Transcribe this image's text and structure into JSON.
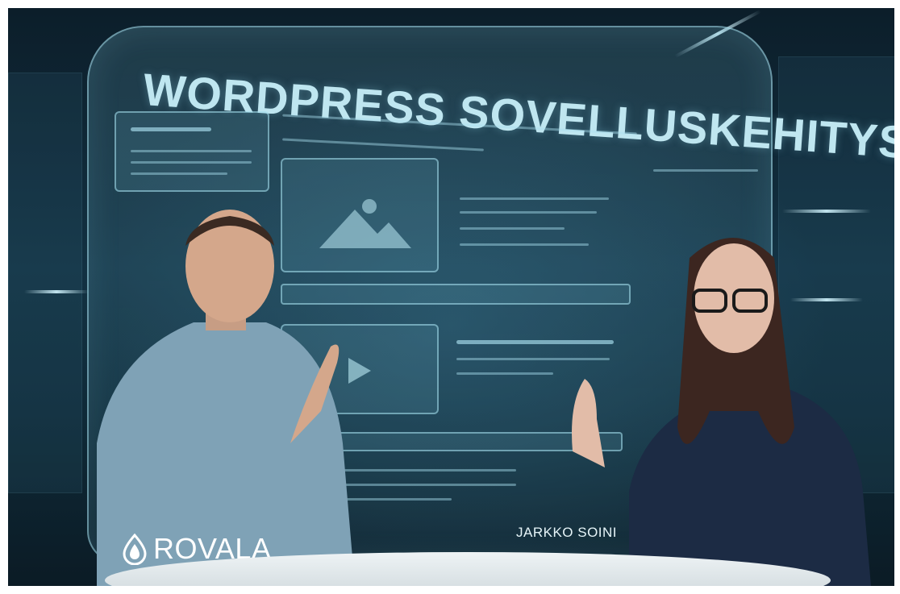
{
  "photo": {
    "headline": "WORDPRESS SOVELLUSKEHITYS",
    "brand": {
      "name": "ROVALA",
      "icon": "drop-icon"
    },
    "author": "JARKKO SOINI"
  },
  "colors": {
    "background": "#0f2a38",
    "glass_text": "#bfe6f0",
    "accent": "#aae1f0",
    "logo": "#ffffff"
  }
}
